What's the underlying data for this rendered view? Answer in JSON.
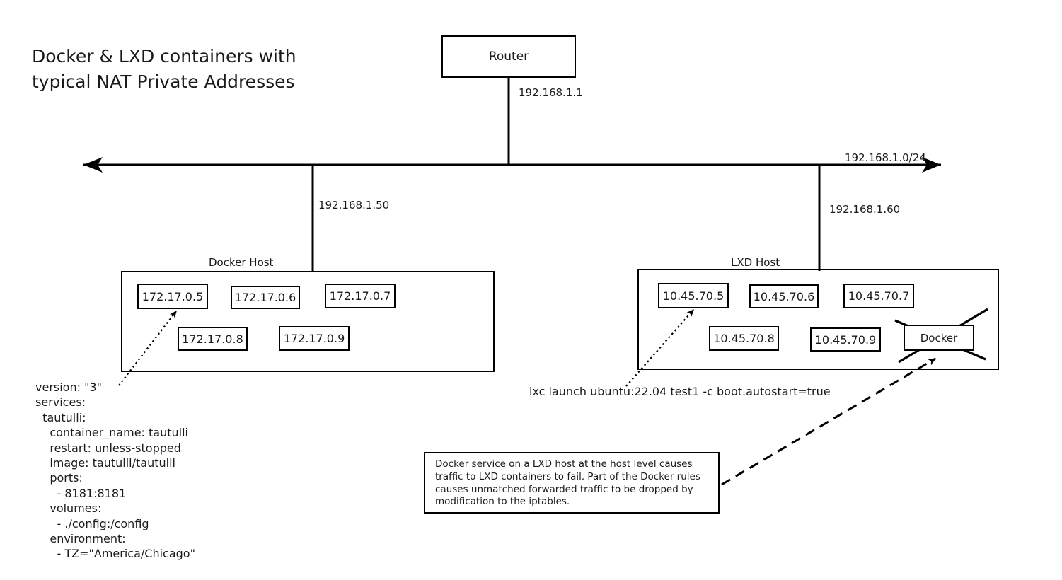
{
  "title": "Docker & LXD containers with\ntypical NAT Private Addresses",
  "network": {
    "router": {
      "label": "Router",
      "ip_label": "192.168.1.1"
    },
    "subnet_label": "192.168.1.0/24",
    "docker_host_ip_label": "192.168.1.50",
    "lxd_host_ip_label": "192.168.1.60"
  },
  "docker_host": {
    "label": "Docker Host",
    "containers": [
      "172.17.0.5",
      "172.17.0.6",
      "172.17.0.7",
      "172.17.0.8",
      "172.17.0.9"
    ]
  },
  "lxd_host": {
    "label": "LXD Host",
    "containers": [
      "10.45.70.5",
      "10.45.70.6",
      "10.45.70.7",
      "10.45.70.8",
      "10.45.70.9"
    ],
    "disabled_service": "Docker"
  },
  "compose_snippet": "version: \"3\"\nservices:\n  tautulli:\n    container_name: tautulli\n    restart: unless-stopped\n    image: tautulli/tautulli\n    ports:\n      - 8181:8181\n    volumes:\n      - ./config:/config\n    environment:\n      - TZ=\"America/Chicago\"",
  "lxc_command": "lxc launch ubuntu:22.04 test1 -c boot.autostart=true",
  "note": "Docker service on a LXD host at the host level causes traffic to LXD containers to fail.  Part of the Docker rules causes unmatched forwarded traffic to be dropped by modification to the iptables.",
  "colors": {
    "stroke": "#000000",
    "text": "#1a1a1a",
    "background": "#ffffff"
  }
}
